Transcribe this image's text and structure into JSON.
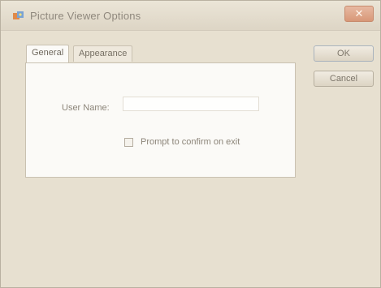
{
  "window": {
    "title": "Picture Viewer Options",
    "close_glyph": "✕"
  },
  "tabs": [
    {
      "label": "General",
      "active": true
    },
    {
      "label": "Appearance",
      "active": false
    }
  ],
  "general": {
    "user_name_label": "User Name:",
    "user_name_value": "",
    "prompt_label": "Prompt to confirm on exit",
    "prompt_checked": false
  },
  "buttons": {
    "ok": "OK",
    "cancel": "Cancel"
  },
  "icons": {
    "app": "picture-viewer-icon",
    "close": "close-icon"
  }
}
